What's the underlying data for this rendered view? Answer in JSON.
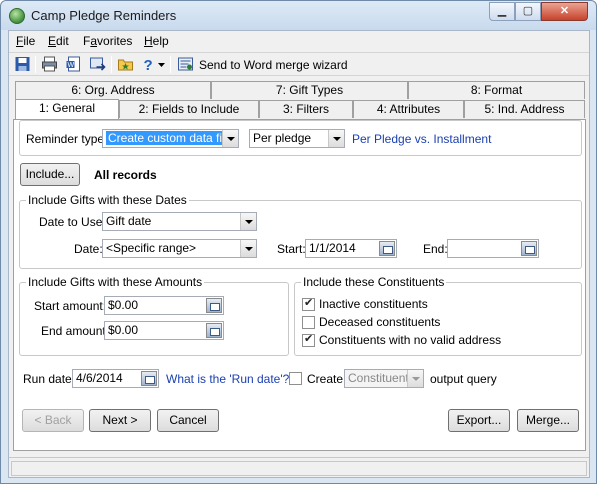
{
  "window": {
    "title": "Camp Pledge Reminders"
  },
  "menu": [
    {
      "label": "File",
      "accel": "F"
    },
    {
      "label": "Edit",
      "accel": "E"
    },
    {
      "label": "Favorites",
      "accel": "a"
    },
    {
      "label": "Help",
      "accel": "H"
    }
  ],
  "toolbar": {
    "merge_label": "Send to Word merge wizard"
  },
  "tabs": {
    "row1": [
      "6: Org. Address",
      "7: Gift Types",
      "8: Format"
    ],
    "row2": [
      "1: General",
      "2: Fields to Include",
      "3: Filters",
      "4: Attributes",
      "5: Ind. Address"
    ]
  },
  "general": {
    "reminder_type_label": "Reminder type:",
    "reminder_type_value": "Create custom data file",
    "per_value": "Per pledge",
    "per_link": "Per Pledge vs. Installment",
    "include_button": "Include...",
    "include_value": "All records",
    "dates_group": "Include Gifts with these Dates",
    "date_to_use_label": "Date to Use:",
    "date_to_use_value": "Gift date",
    "date_label": "Date:",
    "date_value": "<Specific range>",
    "start_label": "Start:",
    "start_value": "1/1/2014",
    "end_label": "End:",
    "end_value": "",
    "amounts_group": "Include Gifts with these Amounts",
    "start_amount_label": "Start amount:",
    "start_amount_value": "$0.00",
    "end_amount_label": "End amount:",
    "end_amount_value": "$0.00",
    "constituents_group": "Include these Constituents",
    "inactive_label": "Inactive constituents",
    "inactive_checked": true,
    "deceased_label": "Deceased constituents",
    "deceased_checked": false,
    "novalid_label": "Constituents with no valid address",
    "novalid_checked": true,
    "run_date_label": "Run date:",
    "run_date_value": "4/6/2014",
    "run_date_link": "What is the 'Run date'?",
    "create_label": "Create",
    "create_checked": false,
    "create_type": "Constituent",
    "output_query_label": "output query"
  },
  "buttons": {
    "back": "< Back",
    "next": "Next >",
    "cancel": "Cancel",
    "export": "Export...",
    "merge": "Merge..."
  }
}
